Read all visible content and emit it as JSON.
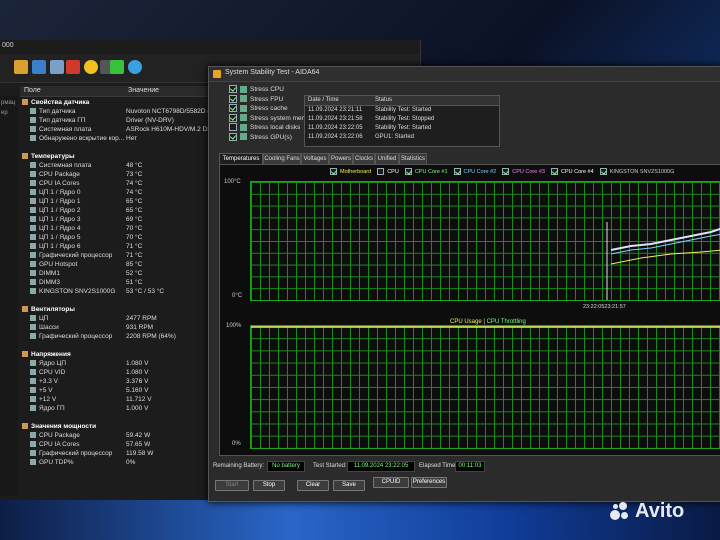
{
  "sensor_window": {
    "title": "000",
    "left_strip": [
      "рмац",
      "ер"
    ],
    "columns": {
      "field": "Поле",
      "value": "Значение"
    },
    "rows": [
      {
        "label": "Свойства датчика",
        "value": "",
        "group": true
      },
      {
        "label": "Тип датчика",
        "value": "Nuvoton NCT6798D/5582D (ISA"
      },
      {
        "label": "Тип датчика ГП",
        "value": "Driver (NV-DRV)"
      },
      {
        "label": "Системная плата",
        "value": "ASRock H610M-HDV/M.2 D5"
      },
      {
        "label": "Обнаружено вскрытие кор...",
        "value": "Нет"
      },
      {
        "label": "",
        "value": ""
      },
      {
        "label": "Температуры",
        "value": "",
        "group": true
      },
      {
        "label": "Системная плата",
        "value": "48 °C"
      },
      {
        "label": "CPU Package",
        "value": "73 °C"
      },
      {
        "label": "CPU IA Cores",
        "value": "74 °C"
      },
      {
        "label": "ЦП 1 / Ядро 0",
        "value": "74 °C"
      },
      {
        "label": "ЦП 1 / Ядро 1",
        "value": "65 °C"
      },
      {
        "label": "ЦП 1 / Ядро 2",
        "value": "65 °C"
      },
      {
        "label": "ЦП 1 / Ядро 3",
        "value": "69 °C"
      },
      {
        "label": "ЦП 1 / Ядро 4",
        "value": "70 °C"
      },
      {
        "label": "ЦП 1 / Ядро 5",
        "value": "70 °C"
      },
      {
        "label": "ЦП 1 / Ядро 6",
        "value": "71 °C"
      },
      {
        "label": "Графический процессор",
        "value": "71 °C"
      },
      {
        "label": "GPU Hotspot",
        "value": "85 °C"
      },
      {
        "label": "DIMM1",
        "value": "52 °C"
      },
      {
        "label": "DIMM3",
        "value": "51 °C"
      },
      {
        "label": "KINGSTON SNV2S1000G",
        "value": "53 °C / 53 °C"
      },
      {
        "label": "",
        "value": ""
      },
      {
        "label": "Вентиляторы",
        "value": "",
        "group": true
      },
      {
        "label": "ЦП",
        "value": "2477 RPM"
      },
      {
        "label": "Шасси",
        "value": "931 RPM"
      },
      {
        "label": "Графический процессор",
        "value": "2208 RPM  (64%)"
      },
      {
        "label": "",
        "value": ""
      },
      {
        "label": "Напряжения",
        "value": "",
        "group": true
      },
      {
        "label": "Ядро ЦП",
        "value": "1.080 V"
      },
      {
        "label": "CPU VID",
        "value": "1.080 V"
      },
      {
        "label": "+3.3 V",
        "value": "3.376 V"
      },
      {
        "label": "+5 V",
        "value": "5.160 V"
      },
      {
        "label": "+12 V",
        "value": "11.712 V"
      },
      {
        "label": "Ядро ГП",
        "value": "1.000 V"
      },
      {
        "label": "",
        "value": ""
      },
      {
        "label": "Значения мощности",
        "value": "",
        "group": true
      },
      {
        "label": "CPU Package",
        "value": "59.42 W"
      },
      {
        "label": "CPU IA Cores",
        "value": "57.65 W"
      },
      {
        "label": "Графический процессор",
        "value": "119.58 W"
      },
      {
        "label": "GPU TDP%",
        "value": "0%"
      }
    ]
  },
  "stability": {
    "title": "System Stability Test - AIDA64",
    "options": [
      {
        "label": "Stress CPU",
        "checked": true
      },
      {
        "label": "Stress FPU",
        "checked": true
      },
      {
        "label": "Stress cache",
        "checked": true
      },
      {
        "label": "Stress system memory",
        "checked": true
      },
      {
        "label": "Stress local disks",
        "checked": false
      },
      {
        "label": "Stress GPU(s)",
        "checked": true
      }
    ],
    "log_headers": {
      "date": "Date / Time",
      "status": "Status"
    },
    "log": [
      {
        "date": "11.09.2024 23:21:11",
        "status": "Stability Test: Started"
      },
      {
        "date": "11.09.2024 23:21:58",
        "status": "Stability Test: Stopped"
      },
      {
        "date": "11.09.2024 23:22:05",
        "status": "Stability Test: Started"
      },
      {
        "date": "11.09.2024 23:22:06",
        "status": "GPU1: Started"
      }
    ],
    "tabs": [
      "Temperatures",
      "Cooling Fans",
      "Voltages",
      "Powers",
      "Clocks",
      "Unified",
      "Statistics"
    ],
    "legend": [
      "Motherboard",
      "CPU",
      "CPU Core #1",
      "CPU Core #2",
      "CPU Core #3",
      "CPU Core #4",
      "KINGSTON SNV2S1000G"
    ],
    "legend_colors": [
      "#f0f060",
      "#ffffff",
      "#7fff7f",
      "#7fd3ff",
      "#ff80ff",
      "#ffffff",
      "#cfcfcf"
    ],
    "temp_top": "100°C",
    "temp_bottom": "0°C",
    "temp_xlabel": "23:22:0523:21:57",
    "usage_top": "100%",
    "usage_bottom": "0%",
    "usage_label": "CPU Usage",
    "usage_sep": "|",
    "throttle_label": "CPU Throttling",
    "remaining_label": "Remaining Battery:",
    "remaining_value": "No battery",
    "started_label": "Test Started:",
    "started_value": "11.09.2024 23:22:05",
    "elapsed_label": "Elapsed Time:",
    "elapsed_value": "00:11:03",
    "buttons": {
      "start": "Start",
      "stop": "Stop",
      "clear": "Clear",
      "save": "Save",
      "cpuid": "CPUID",
      "prefs": "Preferences"
    }
  },
  "watermark": "Avito"
}
